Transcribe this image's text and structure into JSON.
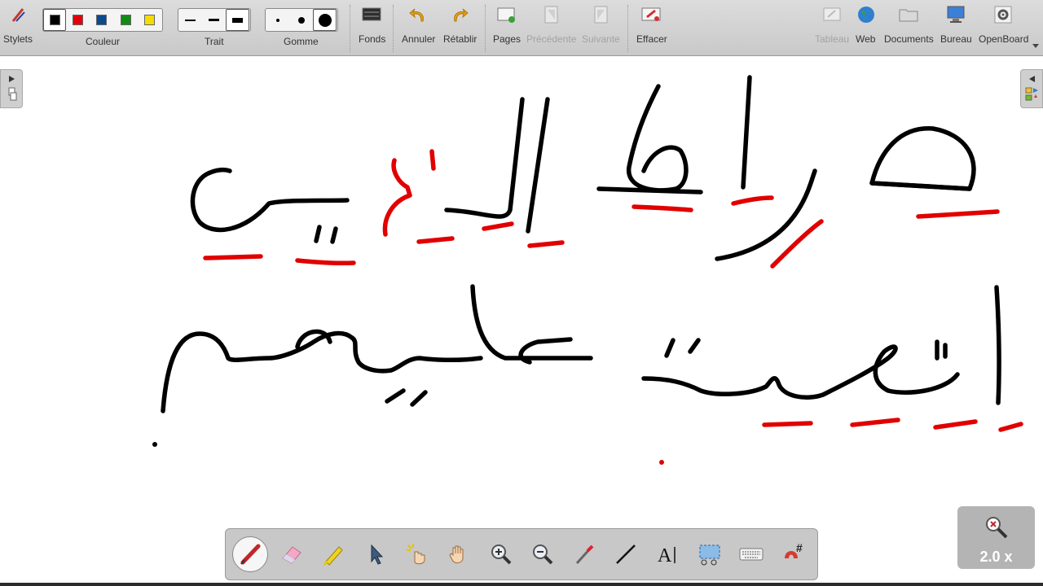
{
  "toolbar": {
    "stylets": "Stylets",
    "couleur": "Couleur",
    "trait": "Trait",
    "gomme": "Gomme",
    "fonds": "Fonds",
    "annuler": "Annuler",
    "retablir": "Rétablir",
    "pages": "Pages",
    "precedente": "Précédente",
    "suivante": "Suivante",
    "effacer": "Effacer",
    "tableau": "Tableau",
    "web": "Web",
    "documents": "Documents",
    "bureau": "Bureau",
    "openboard": "OpenBoard"
  },
  "colors": {
    "swatches": [
      "#000000",
      "#e3000b",
      "#0c4a8e",
      "#128a16",
      "#f3dd00"
    ],
    "selected": "#000000",
    "ink_black": "#000000",
    "ink_red": "#e10000"
  },
  "zoom": {
    "label": "2.0 x"
  },
  "stylus_tools": [
    "pen-icon",
    "eraser-icon",
    "highlighter-icon",
    "selector-icon",
    "laser-pointer-icon",
    "hand-icon",
    "zoom-in-icon",
    "zoom-out-icon",
    "pointer-stick-icon",
    "line-icon",
    "text-icon",
    "capture-icon",
    "keyboard-icon",
    "magnet-grid-icon"
  ]
}
